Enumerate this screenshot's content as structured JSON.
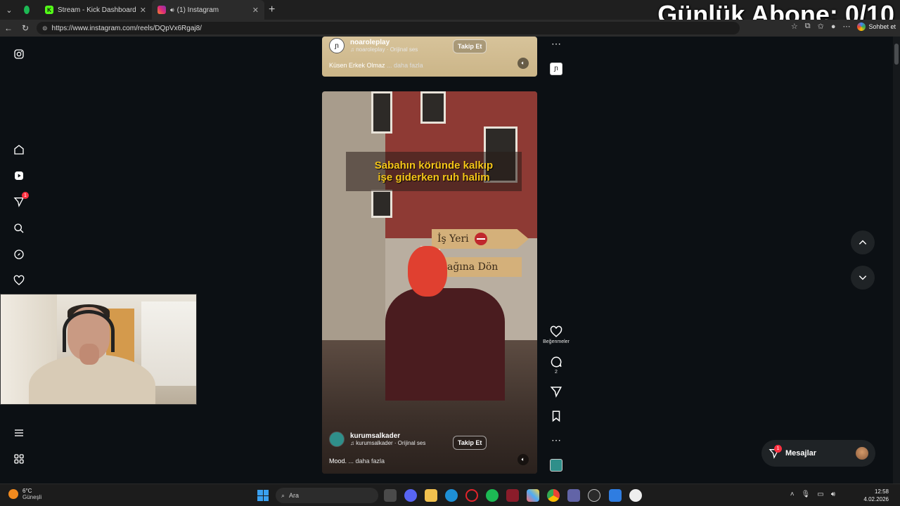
{
  "browser": {
    "tabs": [
      {
        "label": "Stream - Kick Dashboard",
        "favicon": "kick-icon",
        "color": "#53fc18",
        "active": false
      },
      {
        "label": "(1) Instagram",
        "favicon": "instagram-icon",
        "color": "#e1306c",
        "active": true
      }
    ],
    "url": "https://www.instagram.com/reels/DQpVx6Rgaj8/",
    "chat_button": "Sohbet et"
  },
  "overlay": {
    "subscriber_text": "Günlük Abone: 0/10"
  },
  "reels": {
    "top": {
      "username": "noaroleplay",
      "audio": "noaroleplay · Orijinal ses",
      "follow_label": "Takip Et",
      "description": "Küsen Erkek Olmaz",
      "more_label": "... daha fazla"
    },
    "main": {
      "caption_line1": "Sabahın köründe kalkıp",
      "caption_line2": "işe giderken ruh halim",
      "sign1": "İş Yeri",
      "sign2": "ağına Dön",
      "username": "kurumsalkader",
      "audio": "kurumsalkader · Orijinal ses",
      "follow_label": "Takip Et",
      "description": "Mood.",
      "more_label": "... daha fazla"
    }
  },
  "actions": {
    "like_label": "Beğenmeler",
    "comment_count": "2"
  },
  "sidebar": {
    "notification_count": "1"
  },
  "messages": {
    "label": "Mesajlar",
    "badge": "1"
  },
  "taskbar": {
    "weather_temp": "6°C",
    "weather_desc": "Güneşli",
    "search_placeholder": "Ara",
    "time": "12:58",
    "date": "4.02.2026"
  }
}
